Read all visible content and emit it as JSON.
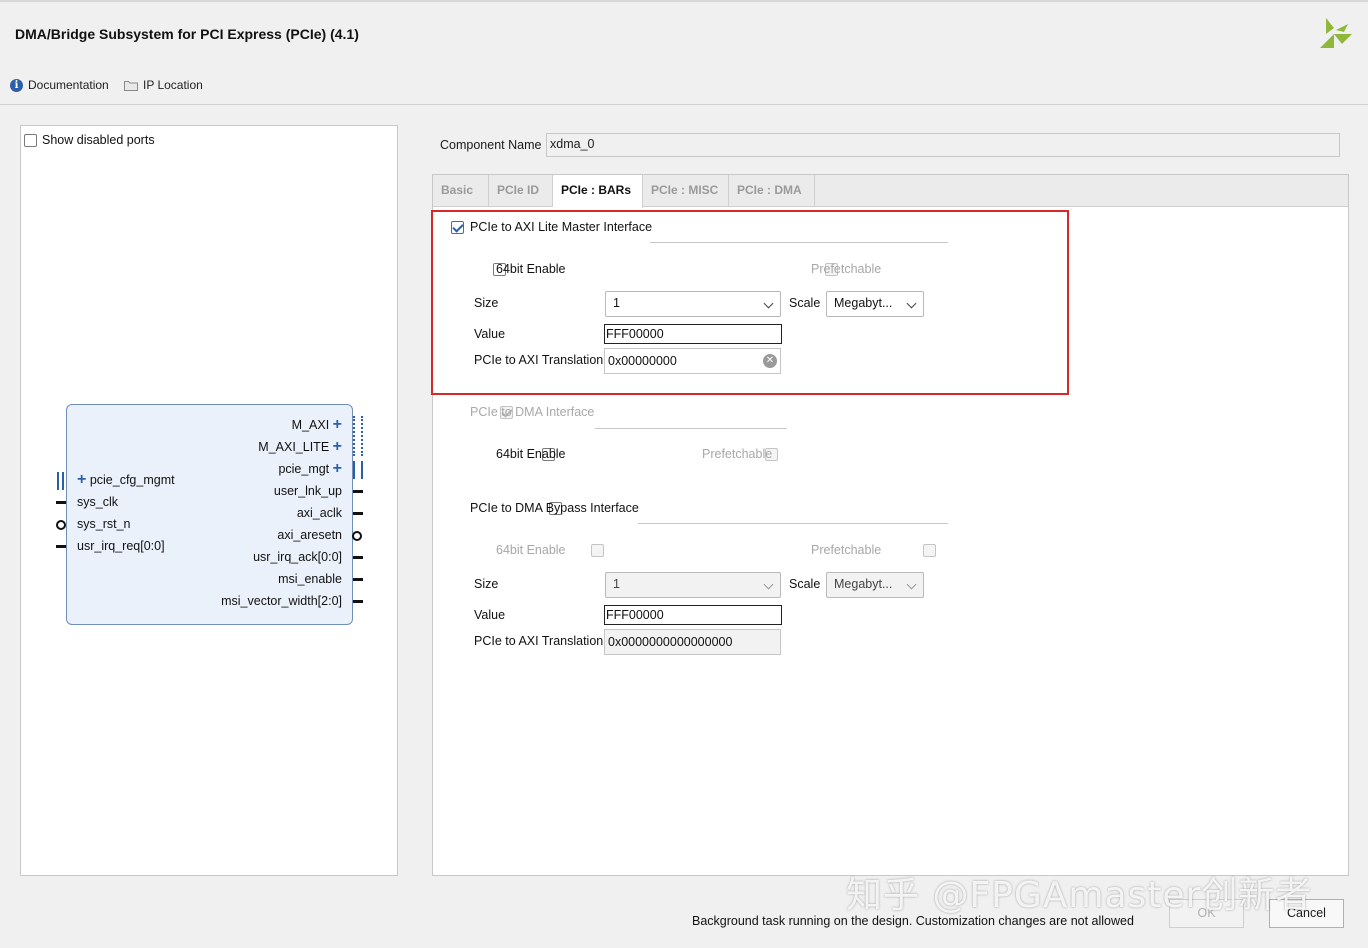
{
  "window": {
    "title": "DMA/Bridge Subsystem for PCI Express (PCIe) (4.1)",
    "logo_icon": "xilinx-logo-icon"
  },
  "toolbar": {
    "documentation_label": "Documentation",
    "ip_location_label": "IP Location"
  },
  "left_panel": {
    "show_disabled_ports_label": "Show disabled ports",
    "show_disabled_ports_checked": false,
    "ip_block": {
      "right_ports": [
        "M_AXI",
        "M_AXI_LITE",
        "pcie_mgt",
        "user_lnk_up",
        "axi_aclk",
        "axi_aresetn",
        "usr_irq_ack[0:0]",
        "msi_enable",
        "msi_vector_width[2:0]"
      ],
      "left_ports": [
        "pcie_cfg_mgmt",
        "sys_clk",
        "sys_rst_n",
        "usr_irq_req[0:0]"
      ]
    }
  },
  "component_name": {
    "label": "Component Name",
    "value": "xdma_0"
  },
  "tabs": [
    {
      "label": "Basic",
      "active": false
    },
    {
      "label": "PCIe ID",
      "active": false
    },
    {
      "label": "PCIe : BARs",
      "active": true
    },
    {
      "label": "PCIe : MISC",
      "active": false
    },
    {
      "label": "PCIe : DMA",
      "active": false
    }
  ],
  "bar_axi_lite": {
    "title": "PCIe to AXI Lite Master Interface",
    "checked": true,
    "enable64_label": "64bit Enable",
    "enable64_checked": false,
    "prefetchable_label": "Prefetchable",
    "size_label": "Size",
    "size_value": "1",
    "scale_label": "Scale",
    "scale_value": "Megabyt...",
    "value_label": "Value",
    "value_value": "FFF00000",
    "translation_label": "PCIe to AXI Translation",
    "translation_value": "0x00000000"
  },
  "bar_dma": {
    "title": "PCIe to DMA Interface",
    "checked": true,
    "enable64_label": "64bit Enable",
    "prefetchable_label": "Prefetchable"
  },
  "bar_bypass": {
    "title": "PCIe to DMA Bypass Interface",
    "checked": false,
    "enable64_label": "64bit Enable",
    "prefetchable_label": "Prefetchable",
    "size_label": "Size",
    "size_value": "1",
    "scale_label": "Scale",
    "scale_value": "Megabyt...",
    "value_label": "Value",
    "value_value": "FFF00000",
    "translation_label": "PCIe to AXI Translation",
    "translation_value": "0x0000000000000000"
  },
  "footer": {
    "status_text": "Background task running on the design. Customization changes are not allowed",
    "ok_label": "OK",
    "cancel_label": "Cancel",
    "watermark": "知乎 @FPGAmaster创新者"
  },
  "colors": {
    "highlight_border": "#d42a2a",
    "accent_blue": "#2d5fa8",
    "ip_block_fill": "#eaf1fb"
  }
}
